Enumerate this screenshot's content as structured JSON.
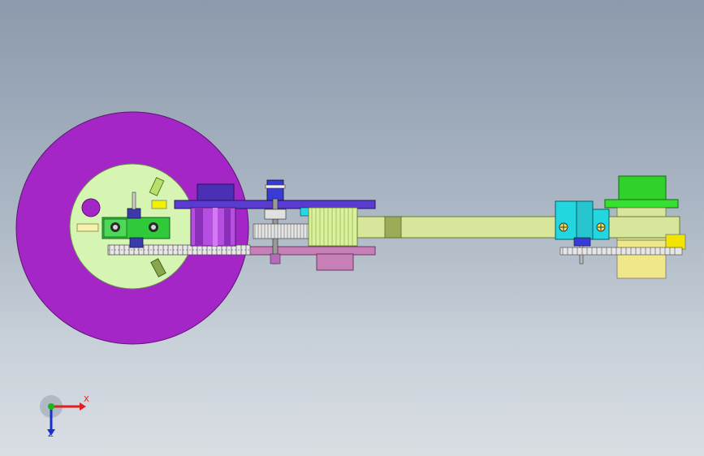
{
  "view": {
    "background_top": "#8c9aad",
    "background_bottom": "#d9dee3"
  },
  "colors": {
    "flywheel": "#a526c6",
    "hub": "#d6f5b2",
    "arm": "#d7e69a",
    "gear_housing": "#4b2fb5",
    "cyan_block": "#22d7e0",
    "green_cap": "#2fd12a",
    "pink_plate": "#c77fb7",
    "yellow_tab": "#f2e400"
  },
  "triad": {
    "x_label": "X",
    "z_label": "Z",
    "x_color": "#e0201c",
    "y_color": "#18b818",
    "z_color": "#1a2fd0"
  }
}
